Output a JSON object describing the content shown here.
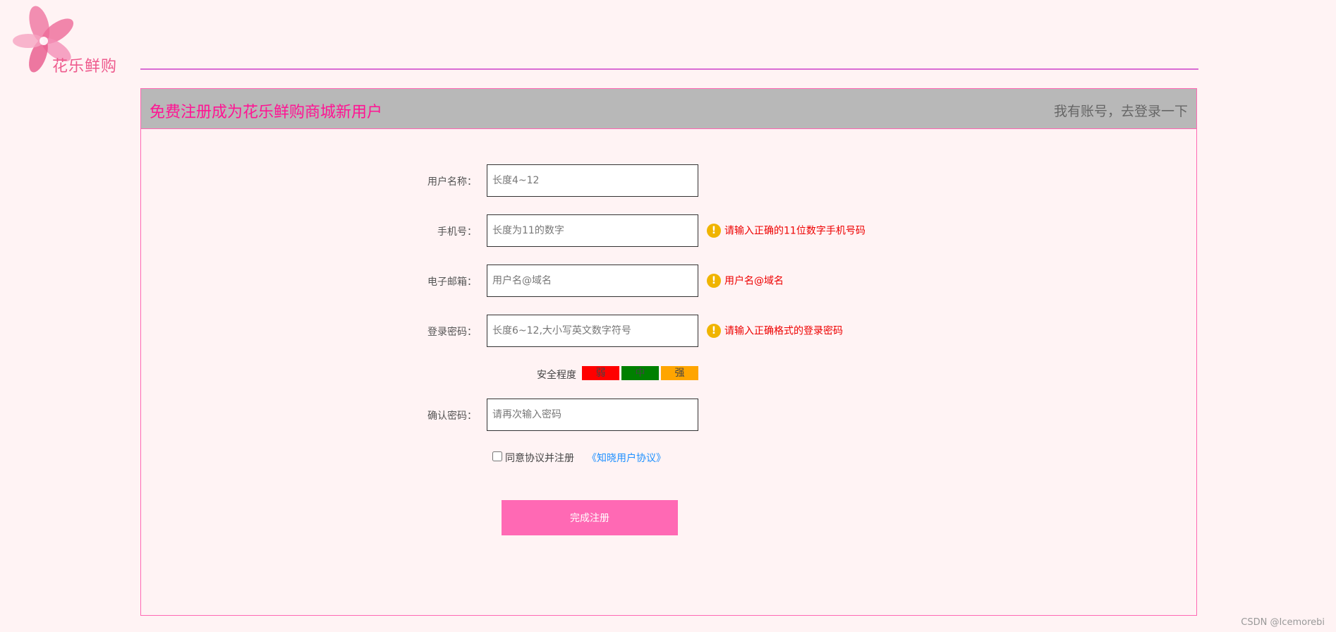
{
  "logo": {
    "text": "花乐鲜购"
  },
  "header": {
    "title": "免费注册成为花乐鲜购商城新用户",
    "login_link": "我有账号，去登录一下"
  },
  "form": {
    "username": {
      "label": "用户名称：",
      "placeholder": "长度4~12"
    },
    "phone": {
      "label": "手机号：",
      "placeholder": "长度为11的数字",
      "hint": "请输入正确的11位数字手机号码"
    },
    "email": {
      "label": "电子邮箱：",
      "placeholder": "用户名@域名",
      "hint": "用户名@域名"
    },
    "password": {
      "label": "登录密码：",
      "placeholder": "长度6~12,大小写英文数字符号",
      "hint": "请输入正确格式的登录密码"
    },
    "strength": {
      "label": "安全程度",
      "levels": [
        {
          "label": "弱",
          "color": "#ff0000"
        },
        {
          "label": "中",
          "color": "#008000"
        },
        {
          "label": "强",
          "color": "#ffa500"
        }
      ]
    },
    "confirm": {
      "label": "确认密码：",
      "placeholder": "请再次输入密码"
    },
    "agree": {
      "text": "同意协议并注册",
      "link": "《知晓用户协议》",
      "checked": false
    },
    "submit": "完成注册",
    "hint_icon": "!"
  },
  "colors": {
    "accent": "#ff69b4",
    "title": "#ff1493",
    "header_bg": "#b8b8b8",
    "hint": "#ee0000",
    "warning_icon": "#f0b400"
  },
  "watermark": "CSDN @Icemorebi"
}
